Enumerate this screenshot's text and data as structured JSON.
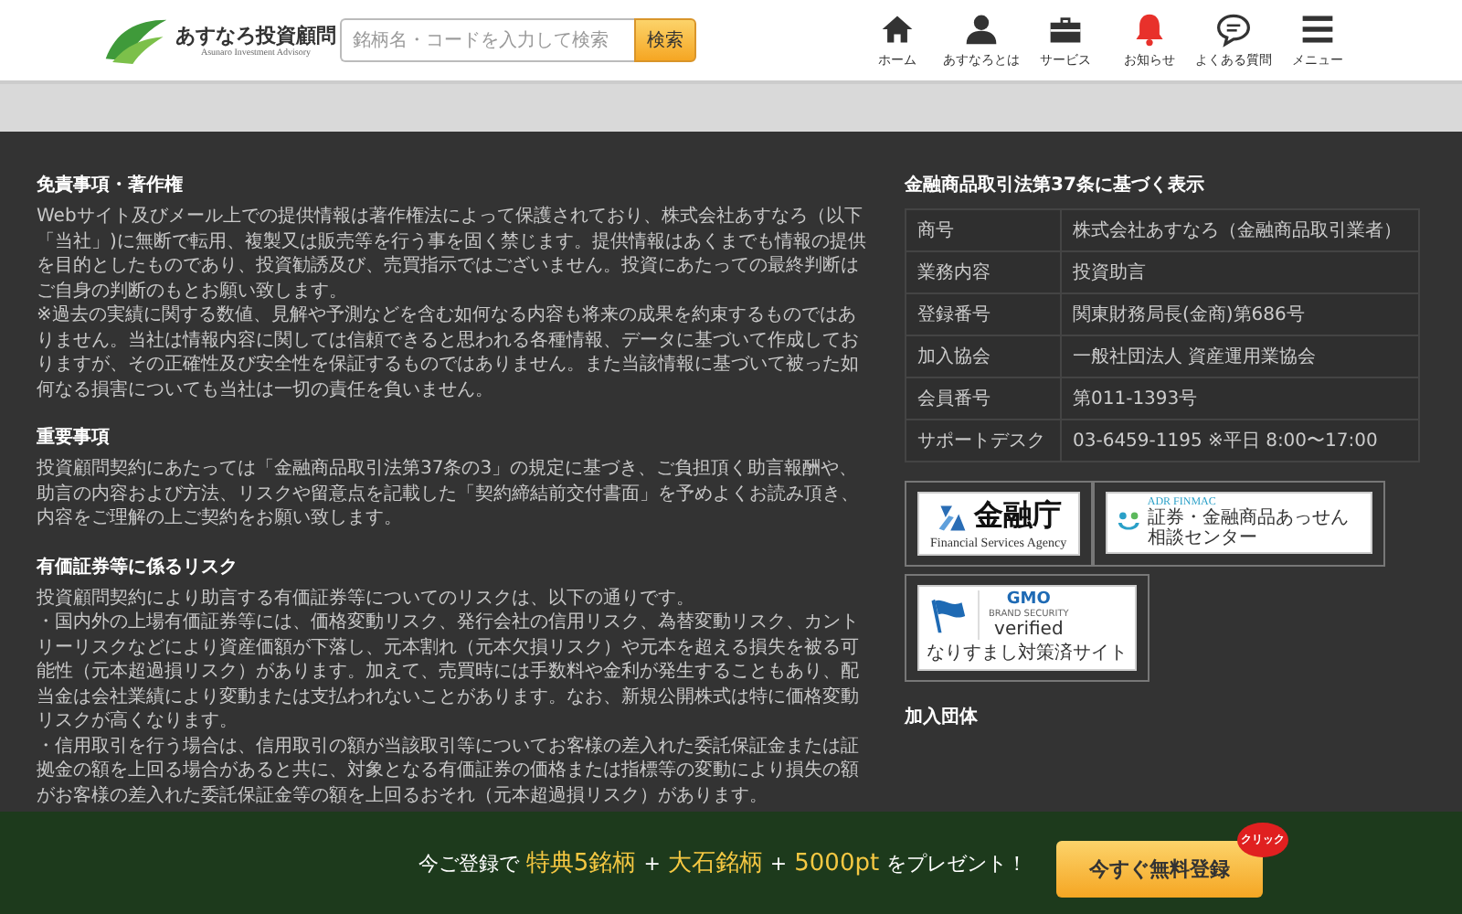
{
  "header": {
    "logo": {
      "name": "あすなろ投資顧問",
      "tagline": "Asunaro Investment Advisory"
    },
    "search": {
      "placeholder": "銘柄名・コードを入力して検索",
      "button": "検索"
    },
    "nav": [
      {
        "label": "ホーム",
        "kind": "home",
        "alert": false
      },
      {
        "label": "あすなろとは",
        "kind": "person",
        "alert": false
      },
      {
        "label": "サービス",
        "kind": "briefcase",
        "alert": false
      },
      {
        "label": "お知らせ",
        "kind": "bell",
        "alert": true
      },
      {
        "label": "よくある質問",
        "kind": "chat",
        "alert": false
      },
      {
        "label": "メニュー",
        "kind": "menu",
        "alert": false
      }
    ]
  },
  "sections": [
    {
      "title": "免責事項・著作権",
      "paragraphs": [
        "Webサイト及びメール上での提供情報は著作権法によって保護されており、株式会社あすなろ（以下「当社」)に無断で転用、複製又は販売等を行う事を固く禁じます。提供情報はあくまでも情報の提供を目的としたものであり、投資勧誘及び、売買指示ではございません。投資にあたっての最終判断はご自身の判断のもとお願い致します。",
        "※過去の実績に関する数値、見解や予測などを含む如何なる内容も将来の成果を約束するものではありません。当社は情報内容に関しては信頼できると思われる各種情報、データに基づいて作成しておりますが、その正確性及び安全性を保証するものではありません。また当該情報に基づいて被った如何なる損害についても当社は一切の責任を負いません。"
      ]
    },
    {
      "title": "重要事項",
      "paragraphs": [
        "投資顧問契約にあたっては「金融商品取引法第37条の3」の規定に基づき、ご負担頂く助言報酬や、助言の内容および方法、リスクや留意点を記載した「契約締結前交付書面」を予めよくお読み頂き、内容をご理解の上ご契約をお願い致します。"
      ]
    },
    {
      "title": "有価証券等に係るリスク",
      "paragraphs": [
        "投資顧問契約により助言する有価証券等についてのリスクは、以下の通りです。",
        "・国内外の上場有価証券等には、価格変動リスク、発行会社の信用リスク、為替変動リスク、カントリーリスクなどにより資産価額が下落し、元本割れ（元本欠損リスク）や元本を超える損失を被る可能性（元本超過損リスク）があります。加えて、売買時には手数料や金利が発生することもあり、配当金は会社業績により変動または支払われないことがあります。なお、新規公開株式は特に価格変動リスクが高くなります。",
        "・信用取引を行う場合は、信用取引の額が当該取引等についてお客様の差入れた委託保証金または証拠金の額を上回る場合があると共に、対象となる有価証券の価格または指標等の変動により損失の額がお客様の差入れた委託保証金等の額を上回るおそれ（元本超過損リスク）があります。"
      ]
    }
  ],
  "disclosure": {
    "title": "金融商品取引法第37条に基づく表示",
    "rows": [
      {
        "label": "商号",
        "value": "株式会社あすなろ（金融商品取引業者）"
      },
      {
        "label": "業務内容",
        "value": "投資助言"
      },
      {
        "label": "登録番号",
        "value": "関東財務局長(金商)第686号"
      },
      {
        "label": "加入協会",
        "value": "一般社団法人 資産運用業協会"
      },
      {
        "label": "会員番号",
        "value": "第011-1393号"
      },
      {
        "label": "サポートデスク",
        "value": "03-6459-1195 ※平日 8:00〜17:00"
      }
    ]
  },
  "badges": [
    {
      "kind": "fsa",
      "title": "金融庁",
      "subtitle": "Financial Services Agency"
    },
    {
      "kind": "finmac",
      "title": "ADR FINMAC",
      "subtitle": "証券・金融商品あっせん相談センター"
    },
    {
      "kind": "gmo",
      "title": "GMO",
      "subtitle": "BRAND SECURITY",
      "status": "verified",
      "note": "なりすまし対策済サイト"
    }
  ],
  "membership": {
    "title": "加入団体"
  },
  "banner": {
    "segments": [
      {
        "text": "今ご登録で",
        "highlight": false
      },
      {
        "text": "特典5銘柄",
        "highlight": true
      },
      {
        "text": "+",
        "highlight": false
      },
      {
        "text": "大石銘柄",
        "highlight": true
      },
      {
        "text": "+",
        "highlight": false
      },
      {
        "text": "5000pt",
        "highlight": true
      },
      {
        "text": "をプレゼント！",
        "highlight": false
      }
    ],
    "button": "今すぐ無料登録",
    "badge": "クリック"
  }
}
